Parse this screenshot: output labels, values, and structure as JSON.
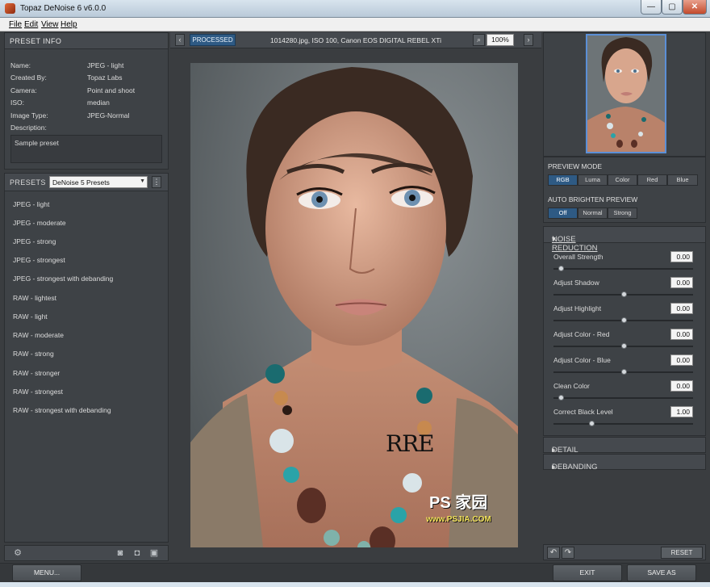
{
  "window": {
    "title": "Topaz DeNoise 6 v6.0.0",
    "min": "—",
    "max": "▢",
    "close": "✕"
  },
  "menu": [
    "File",
    "Edit",
    "View",
    "Help"
  ],
  "preset_info": {
    "header": "PRESET INFO",
    "rows": [
      {
        "label": "Name:",
        "value": "JPEG - light"
      },
      {
        "label": "Created By:",
        "value": "Topaz Labs"
      },
      {
        "label": "Camera:",
        "value": "Point and shoot"
      },
      {
        "label": "ISO:",
        "value": "median"
      },
      {
        "label": "Image Type:",
        "value": "JPEG-Normal"
      },
      {
        "label": "Description:",
        "value": ""
      }
    ],
    "description": "Sample preset"
  },
  "presets": {
    "header": "PRESETS",
    "dropdown": "DeNoise 5 Presets",
    "items": [
      "JPEG - light",
      "JPEG - moderate",
      "JPEG - strong",
      "JPEG - strongest",
      "JPEG - strongest with debanding",
      "RAW - lightest",
      "RAW - light",
      "RAW - moderate",
      "RAW - strong",
      "RAW - stronger",
      "RAW - strongest",
      "RAW - strongest with debanding"
    ]
  },
  "viewer": {
    "mode_label": "PROCESSED",
    "file_info": "1014280.jpg, ISO 100, Canon EOS DIGITAL REBEL XTi",
    "zoom": "100%",
    "watermark": "RRE",
    "site_mark": "PS 家园",
    "site_url": "www.PSJIA.COM"
  },
  "preview_mode": {
    "header": "PREVIEW MODE",
    "options": [
      "RGB",
      "Luma",
      "Color",
      "Red",
      "Blue"
    ],
    "selected": "RGB"
  },
  "auto_brighten": {
    "header": "AUTO BRIGHTEN PREVIEW",
    "options": [
      "Off",
      "Normal",
      "Strong"
    ],
    "selected": "Off"
  },
  "noise_reduction": {
    "header": "NOISE REDUCTION",
    "sliders": [
      {
        "label": "Overall Strength",
        "value": "0.00",
        "level": 0.05
      },
      {
        "label": "Adjust Shadow",
        "value": "0.00",
        "level": 0.5
      },
      {
        "label": "Adjust Highlight",
        "value": "0.00",
        "level": 0.5
      },
      {
        "label": "Adjust Color - Red",
        "value": "0.00",
        "level": 0.5
      },
      {
        "label": "Adjust Color - Blue",
        "value": "0.00",
        "level": 0.5
      },
      {
        "label": "Clean Color",
        "value": "0.00",
        "level": 0.05
      },
      {
        "label": "Correct Black Level",
        "value": "1.00",
        "level": 0.27
      }
    ]
  },
  "sections": [
    "DETAIL RECOVERY",
    "DEBANDING"
  ],
  "buttons": {
    "reset": "RESET",
    "menu": "MENU...",
    "exit": "EXIT",
    "save_as": "SAVE AS"
  },
  "colors": {
    "accent": "#2e5a84",
    "panel": "#3e4246",
    "background": "#3a3d40"
  }
}
